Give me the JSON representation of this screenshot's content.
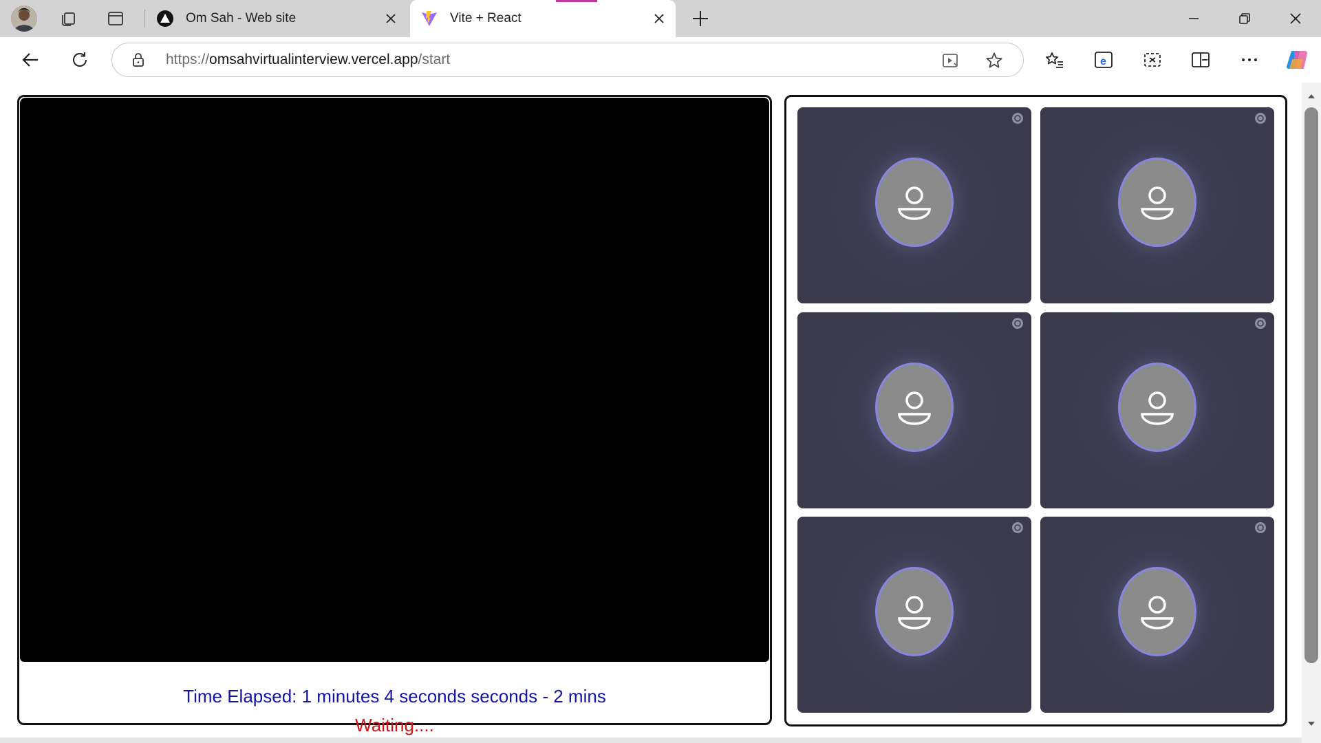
{
  "browser": {
    "tabs": [
      {
        "title": "Om Sah - Web site",
        "active": false,
        "favicon": "triangle-logo-icon"
      },
      {
        "title": "Vite + React",
        "active": true,
        "favicon": "vite-logo-icon"
      }
    ],
    "url": {
      "scheme": "https://",
      "host": "omsahvirtualinterview.vercel.app",
      "path": "/start"
    },
    "accent_colors": {
      "tab_loading": "#c0399e",
      "edge_blue": "#1a73e8"
    }
  },
  "interview": {
    "timer_text": "Time Elapsed: 1 minutes 4 seconds seconds - 2 mins",
    "status_text": "Waiting....",
    "timer_color": "#1414a8",
    "status_color": "#d01515"
  },
  "participants": [
    {
      "icon": "user-avatar-icon"
    },
    {
      "icon": "user-avatar-icon"
    },
    {
      "icon": "user-avatar-icon"
    },
    {
      "icon": "user-avatar-icon"
    },
    {
      "icon": "user-avatar-icon"
    },
    {
      "icon": "user-avatar-icon"
    }
  ]
}
